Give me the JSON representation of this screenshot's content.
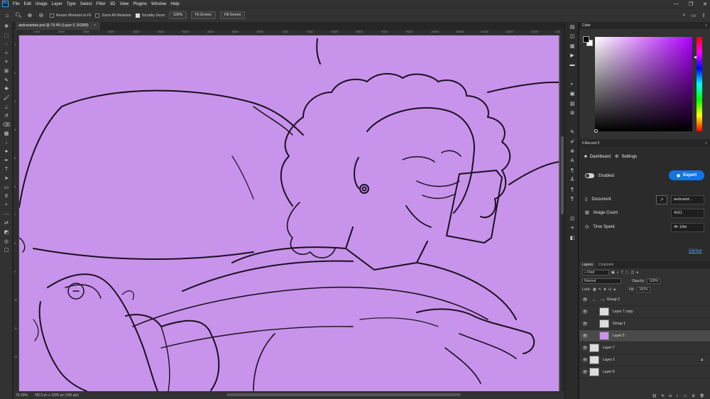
{
  "menu": {
    "app_icon": "Ps",
    "items": [
      "File",
      "Edit",
      "Image",
      "Layer",
      "Type",
      "Select",
      "Filter",
      "3D",
      "View",
      "Plugins",
      "Window",
      "Help"
    ]
  },
  "options": {
    "resize_label": "Resize Windows to Fit",
    "zoom_all_label": "Zoom All Windows",
    "scrubby_label": "Scrubby Zoom",
    "zoom_pct": "100%",
    "fit_screen": "Fit Screen",
    "fill_screen": "Fill Screen"
  },
  "document": {
    "tab_title": "asdcsswdws.psd @ 79.4% (Layer 5, RGB/8)",
    "status_zoom": "79.39%",
    "status_info": "3613 px x 3326 px (300 ppi)"
  },
  "ruler": {
    "h_ticks": [
      "2100",
      "2600",
      "3000",
      "3500",
      "4000",
      "4500",
      "5000",
      "5500",
      "6000",
      "6500",
      "7000",
      "7500",
      "8000",
      "8500",
      "9000",
      "9500",
      "10000",
      "10500",
      "11000",
      "11500",
      "12000",
      "12500"
    ],
    "v_ticks": [
      "1",
      "2",
      "3",
      "4",
      "5",
      "6",
      "7",
      "8",
      "9",
      "10",
      "11",
      "12"
    ]
  },
  "color_panel": {
    "title": "Color",
    "hue_color": "#b000ff",
    "foreground": "#000000",
    "background": "#ffffff"
  },
  "frecord": {
    "title": "F.Record 3",
    "tab_dashboard": "Dashboard",
    "tab_settings": "Settings",
    "enabled_label": "Enabled",
    "export_label": "Export",
    "document_label": "Document",
    "document_value": "asdcswd...",
    "image_count_label": "Image Count",
    "image_count_value": "4161",
    "time_spent_label": "Time Spent",
    "time_spent_value": "4h 10m",
    "github_label": "GitHub"
  },
  "layers": {
    "tab_layers": "Layers",
    "tab_channels": "Channels",
    "filter_kind": "Kind",
    "blend_mode": "Normal",
    "opacity_label": "Opacity:",
    "opacity_value": "100%",
    "lock_label": "Lock:",
    "fill_label": "Fill:",
    "fill_value": "100%",
    "rows": [
      {
        "name": "Group 2"
      },
      {
        "name": "Layer 7 copy"
      },
      {
        "name": "Group 1"
      },
      {
        "name": "Layer 5"
      },
      {
        "name": "Layer 7"
      },
      {
        "name": "Layer 2"
      },
      {
        "name": "Layer 6"
      }
    ]
  },
  "colors": {
    "canvas_bg": "#c893ea",
    "accent": "#1473e6",
    "link": "#4b9cf5"
  }
}
